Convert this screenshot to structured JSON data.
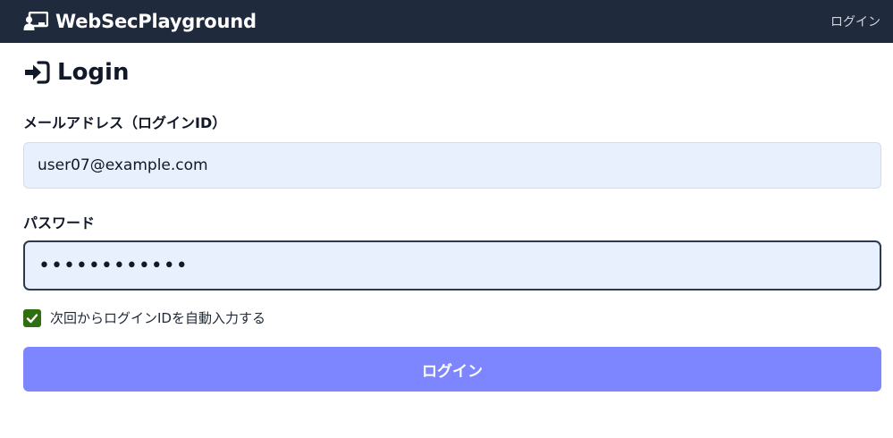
{
  "navbar": {
    "brand": "WebSecPlayground",
    "brand_icon": "chalkboard-user-icon",
    "login_link": "ログイン",
    "background": "#1f2a3c"
  },
  "page": {
    "title": "Login",
    "title_icon": "sign-in-icon"
  },
  "form": {
    "email": {
      "label": "メールアドレス（ログインID）",
      "value": "user07@example.com"
    },
    "password": {
      "label": "パスワード",
      "value": "••••••••••••"
    },
    "remember": {
      "label": "次回からログインIDを自動入力する",
      "checked": true,
      "color": "#2f6f12"
    },
    "submit_label": "ログイン",
    "submit_color": "#7e86ff"
  }
}
